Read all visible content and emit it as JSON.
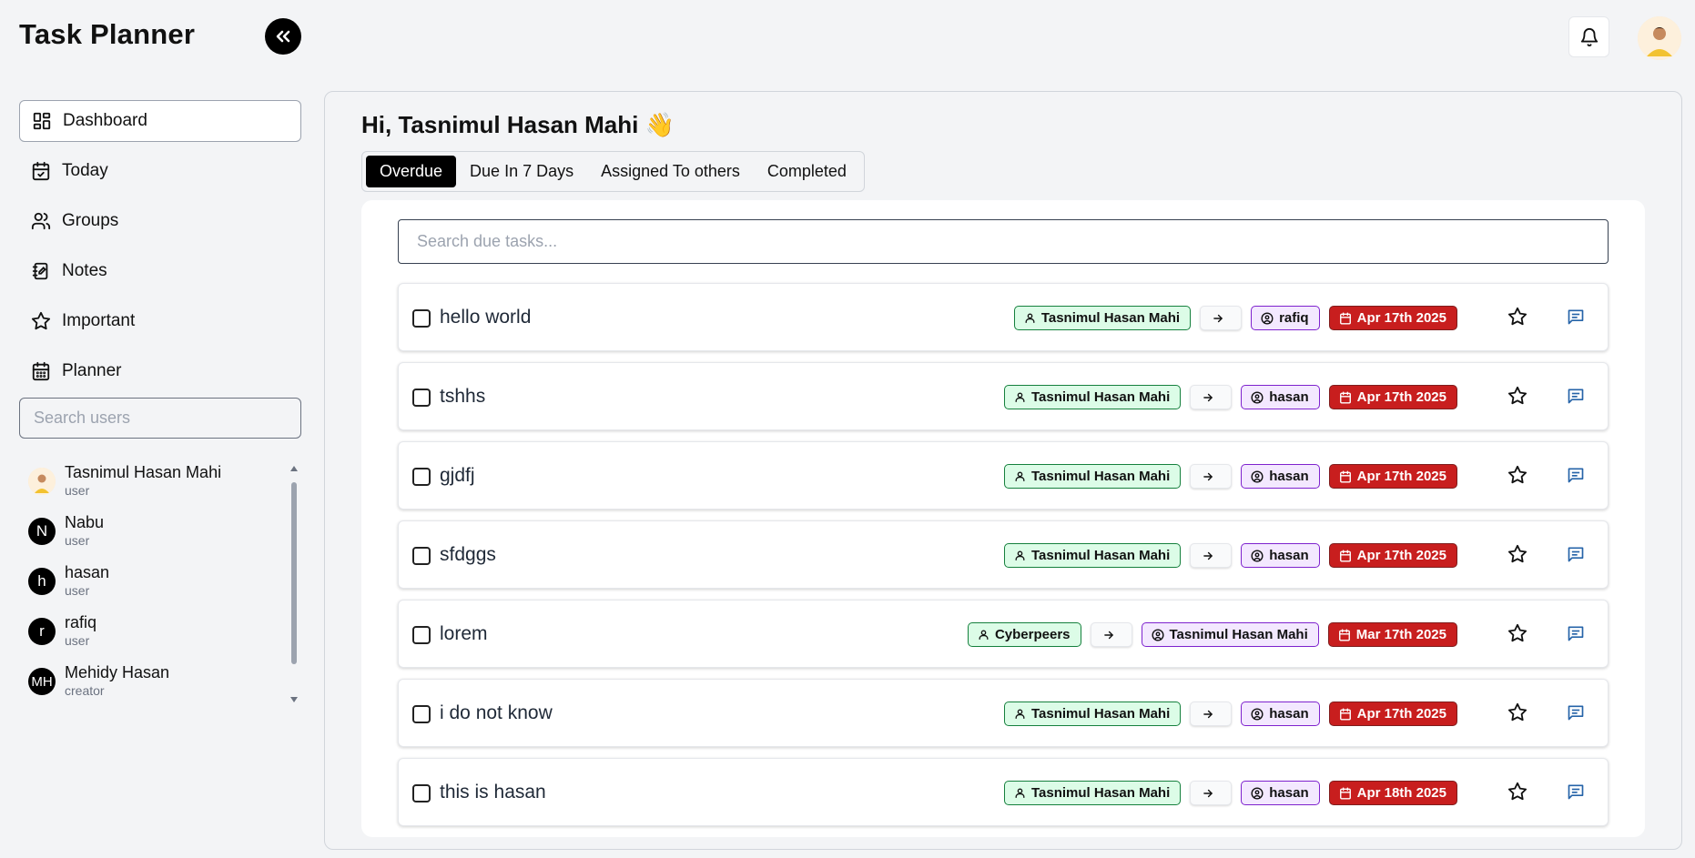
{
  "app": {
    "title": "Task Planner"
  },
  "header": {
    "notifications_icon": "bell-icon",
    "collapse_icon": "chevrons-left-icon"
  },
  "sidebar": {
    "items": [
      {
        "label": "Dashboard",
        "icon": "dashboard-icon",
        "active": true
      },
      {
        "label": "Today",
        "icon": "calendar-check-icon"
      },
      {
        "label": "Groups",
        "icon": "users-icon"
      },
      {
        "label": "Notes",
        "icon": "notebook-icon"
      },
      {
        "label": "Important",
        "icon": "star-icon"
      },
      {
        "label": "Planner",
        "icon": "calendar-grid-icon"
      }
    ],
    "search_placeholder": "Search users",
    "users": [
      {
        "name": "Tasnimul Hasan Mahi",
        "role": "user",
        "initial": ""
      },
      {
        "name": "Nabu",
        "role": "user",
        "initial": "N"
      },
      {
        "name": "hasan",
        "role": "user",
        "initial": "h"
      },
      {
        "name": "rafiq",
        "role": "user",
        "initial": "r"
      },
      {
        "name": "Mehidy Hasan",
        "role": "creator",
        "initial": "MH"
      }
    ]
  },
  "main": {
    "greeting": "Hi, Tasnimul Hasan Mahi 👋",
    "tabs": [
      {
        "label": "Overdue",
        "active": true
      },
      {
        "label": "Due In 7 Days"
      },
      {
        "label": "Assigned To others"
      },
      {
        "label": "Completed"
      }
    ],
    "search_placeholder": "Search due tasks...",
    "tasks": [
      {
        "title": "hello world",
        "from": "Tasnimul Hasan Mahi",
        "to": "rafiq",
        "due": "Apr 17th 2025"
      },
      {
        "title": "tshhs",
        "from": "Tasnimul Hasan Mahi",
        "to": "hasan",
        "due": "Apr 17th 2025"
      },
      {
        "title": "gjdfj",
        "from": "Tasnimul Hasan Mahi",
        "to": "hasan",
        "due": "Apr 17th 2025"
      },
      {
        "title": "sfdggs",
        "from": "Tasnimul Hasan Mahi",
        "to": "hasan",
        "due": "Apr 17th 2025"
      },
      {
        "title": "lorem",
        "from": "Cyberpeers",
        "to": "Tasnimul Hasan Mahi",
        "due": "Mar 17th 2025"
      },
      {
        "title": "i do not know",
        "from": "Tasnimul Hasan Mahi",
        "to": "hasan",
        "due": "Apr 17th 2025"
      },
      {
        "title": "this is hasan",
        "from": "Tasnimul Hasan Mahi",
        "to": "hasan",
        "due": "Apr 18th 2025"
      }
    ]
  },
  "colors": {
    "accent": "#000000",
    "overdue": "#c81e1e",
    "from_chip": "#dcfce7",
    "to_chip": "#f3e8ff"
  }
}
